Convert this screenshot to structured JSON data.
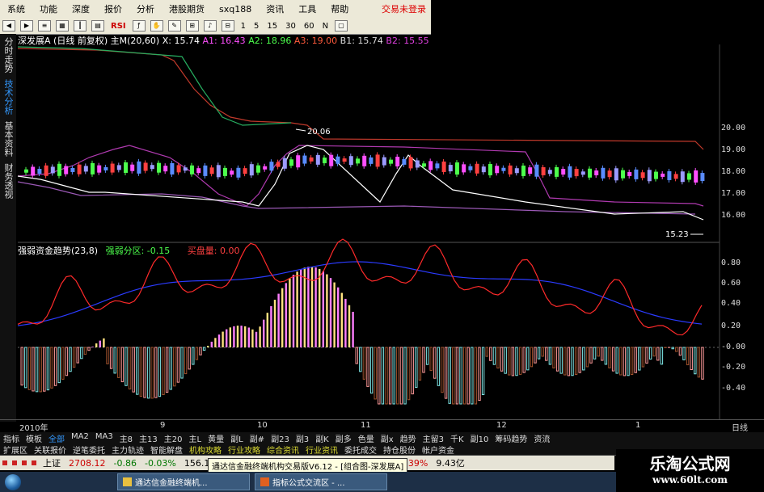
{
  "menu": {
    "items": [
      "系统",
      "功能",
      "深度",
      "报价",
      "分析",
      "港股期货",
      "sxq188",
      "资讯",
      "工具",
      "帮助"
    ],
    "right_status": "交易未登录"
  },
  "toolbar": {
    "rsi": "RSI",
    "periods": [
      "1",
      "5",
      "15",
      "30",
      "60",
      "N"
    ]
  },
  "sidebar": {
    "tabs": [
      "分时走势",
      "技术分析",
      "基本资料",
      "财务透视"
    ],
    "active": 1
  },
  "kline": {
    "title": "深发展A",
    "subtitle": "(日线 前复权)",
    "main_label": "主M(20,60)",
    "x_label": "X:",
    "x_value": "15.74",
    "a1_label": "A1:",
    "a1_value": "16.43",
    "a2_label": "A2:",
    "a2_value": "18.96",
    "a3_label": "A3:",
    "a3_value": "19.00",
    "b1_label": "B1:",
    "b1_value": "15.74",
    "b2_label": "B2:",
    "b2_value": "15.55",
    "high_mark": "20.06",
    "low_mark": "15.23",
    "y_ticks": [
      "20.00",
      "19.00",
      "18.00",
      "17.00",
      "16.00"
    ]
  },
  "indicator": {
    "name": "强弱资金趋势(23,8)",
    "zone_label": "强弱分区:",
    "zone_value": "-0.15",
    "buy_label": "买盘量:",
    "buy_value": "0.00",
    "y_ticks": [
      "0.80",
      "0.60",
      "0.40",
      "0.20",
      "-0.00",
      "-0.20",
      "-0.40"
    ]
  },
  "time_axis": {
    "labels": [
      "2010年",
      "9",
      "10",
      "11",
      "12",
      "1"
    ],
    "right": "日线"
  },
  "tabs_row1": [
    "指标",
    "模板",
    "全部",
    "MA2",
    "MA3",
    "主8",
    "主13",
    "主20",
    "主L",
    "黄量",
    "副L",
    "副#",
    "副23",
    "副3",
    "副K",
    "副多",
    "色量",
    "副x",
    "趋势",
    "主留3",
    "千K",
    "副10",
    "筹码趋势",
    "资流"
  ],
  "tabs_row2": [
    "扩展区",
    "关联报价",
    "逆笔委托",
    "主力轨迹",
    "智能解盘",
    "机构攻略",
    "行业攻略",
    "综合资讯",
    "行业资讯",
    "委托成交",
    "持仓股份",
    "帐户资金"
  ],
  "statusbar": {
    "index_name": "上证",
    "index_value": "2708.12",
    "change": "-0.86",
    "pct": "-0.03%",
    "volume": "156.1亿",
    "other_pct_a": "95",
    "other_pct_b": "0.39%",
    "other_vol": "9.43亿"
  },
  "tooltip": "通达信金融终端机构交易版V6.12 - [组合图-深发展A]",
  "taskbar": {
    "tasks": [
      "通达信金融终端机...",
      "指标公式交流区 - ..."
    ]
  },
  "watermark": {
    "line1": "乐淘公式网",
    "line2": "www.60lt.com"
  }
}
